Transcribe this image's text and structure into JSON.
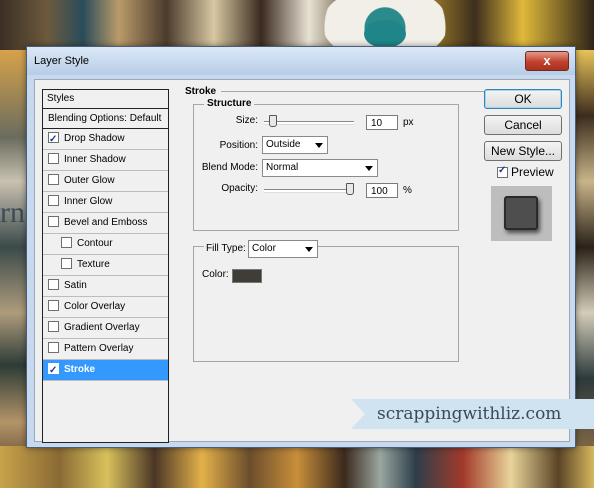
{
  "window": {
    "title": "Layer Style",
    "close_glyph": "x"
  },
  "styles_panel": {
    "header": "Styles",
    "items": [
      {
        "label": "Blending Options: Default",
        "checkbox": false,
        "checked": false,
        "indent": false,
        "selected": false
      },
      {
        "label": "Drop Shadow",
        "checkbox": true,
        "checked": true,
        "indent": false,
        "selected": false
      },
      {
        "label": "Inner Shadow",
        "checkbox": true,
        "checked": false,
        "indent": false,
        "selected": false
      },
      {
        "label": "Outer Glow",
        "checkbox": true,
        "checked": false,
        "indent": false,
        "selected": false
      },
      {
        "label": "Inner Glow",
        "checkbox": true,
        "checked": false,
        "indent": false,
        "selected": false
      },
      {
        "label": "Bevel and Emboss",
        "checkbox": true,
        "checked": false,
        "indent": false,
        "selected": false
      },
      {
        "label": "Contour",
        "checkbox": true,
        "checked": false,
        "indent": true,
        "selected": false
      },
      {
        "label": "Texture",
        "checkbox": true,
        "checked": false,
        "indent": true,
        "selected": false
      },
      {
        "label": "Satin",
        "checkbox": true,
        "checked": false,
        "indent": false,
        "selected": false
      },
      {
        "label": "Color Overlay",
        "checkbox": true,
        "checked": false,
        "indent": false,
        "selected": false
      },
      {
        "label": "Gradient Overlay",
        "checkbox": true,
        "checked": false,
        "indent": false,
        "selected": false
      },
      {
        "label": "Pattern Overlay",
        "checkbox": true,
        "checked": false,
        "indent": false,
        "selected": false
      },
      {
        "label": "Stroke",
        "checkbox": true,
        "checked": true,
        "indent": false,
        "selected": true
      }
    ]
  },
  "stroke": {
    "section_title": "Stroke",
    "structure_title": "Structure",
    "size": {
      "label": "Size:",
      "value": "10",
      "unit": "px",
      "slider_fraction": 0.1
    },
    "position": {
      "label": "Position:",
      "value": "Outside"
    },
    "blend_mode": {
      "label": "Blend Mode:",
      "value": "Normal"
    },
    "opacity": {
      "label": "Opacity:",
      "value": "100",
      "unit": "%",
      "slider_fraction": 1.0
    },
    "fill_type": {
      "label": "Fill Type:",
      "value": "Color"
    },
    "color": {
      "label": "Color:",
      "value": "#403c38"
    }
  },
  "buttons": {
    "ok": "OK",
    "cancel": "Cancel",
    "new_style": "New Style..."
  },
  "preview": {
    "label": "Preview",
    "checked": true,
    "swatch_color": "#4e4e4e"
  },
  "background": {
    "text": "rn"
  },
  "watermark": "scrappingwithliz.com"
}
